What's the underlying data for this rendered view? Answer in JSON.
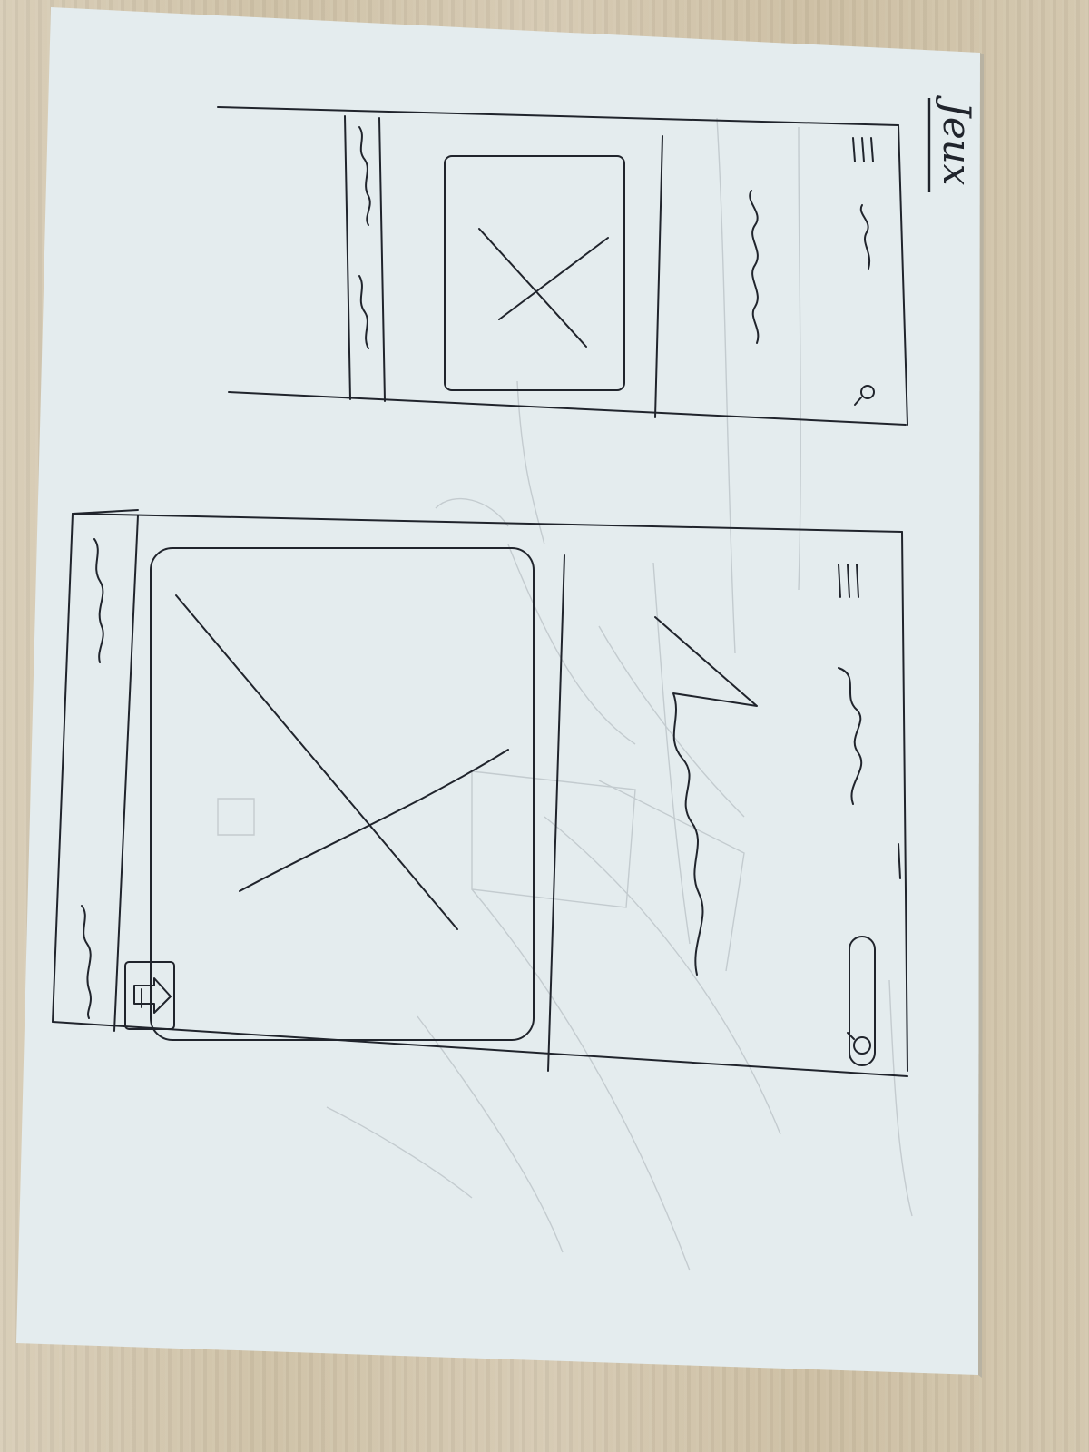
{
  "sheet": {
    "heading": "Jeux",
    "colors": {
      "paper": "#e4ecee",
      "ink": "#20242c",
      "pencil_ghost": "#a9b1b6",
      "table": "#d4c9b2"
    }
  },
  "mobile_wireframe": {
    "header": {
      "menu_icon": "hamburger-icon",
      "search_icon": "search-icon"
    },
    "image_placeholder_icon": "image-placeholder-x-icon"
  },
  "tablet_wireframe": {
    "header": {
      "menu_icon": "hamburger-icon",
      "search_field_icon": "search-icon"
    },
    "image_placeholder_icon": "image-placeholder-x-icon",
    "overlay_button_icon": "arrow-icon"
  }
}
